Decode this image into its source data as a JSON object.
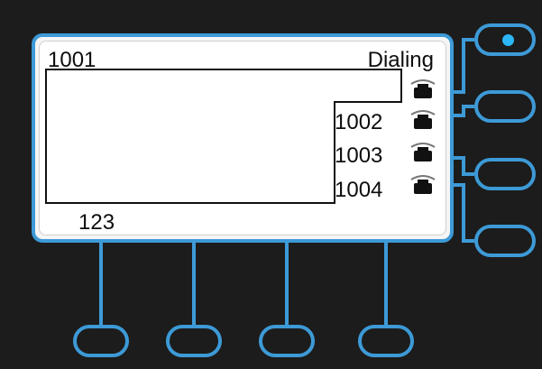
{
  "screen": {
    "line_number": "1001",
    "call_status": "Dialing",
    "dialed_digits": "123"
  },
  "lines": [
    {
      "label": "",
      "icon": "phone-handset-icon",
      "state": "active"
    },
    {
      "label": "1002",
      "icon": "phone-handset-icon",
      "state": "idle"
    },
    {
      "label": "1003",
      "icon": "phone-handset-icon",
      "state": "idle"
    },
    {
      "label": "1004",
      "icon": "phone-handset-icon",
      "state": "idle"
    }
  ],
  "colors": {
    "accent": "#3d9ad7",
    "led": "#2bb7f5",
    "background": "#1c1c1c",
    "screen": "#ffffff"
  }
}
